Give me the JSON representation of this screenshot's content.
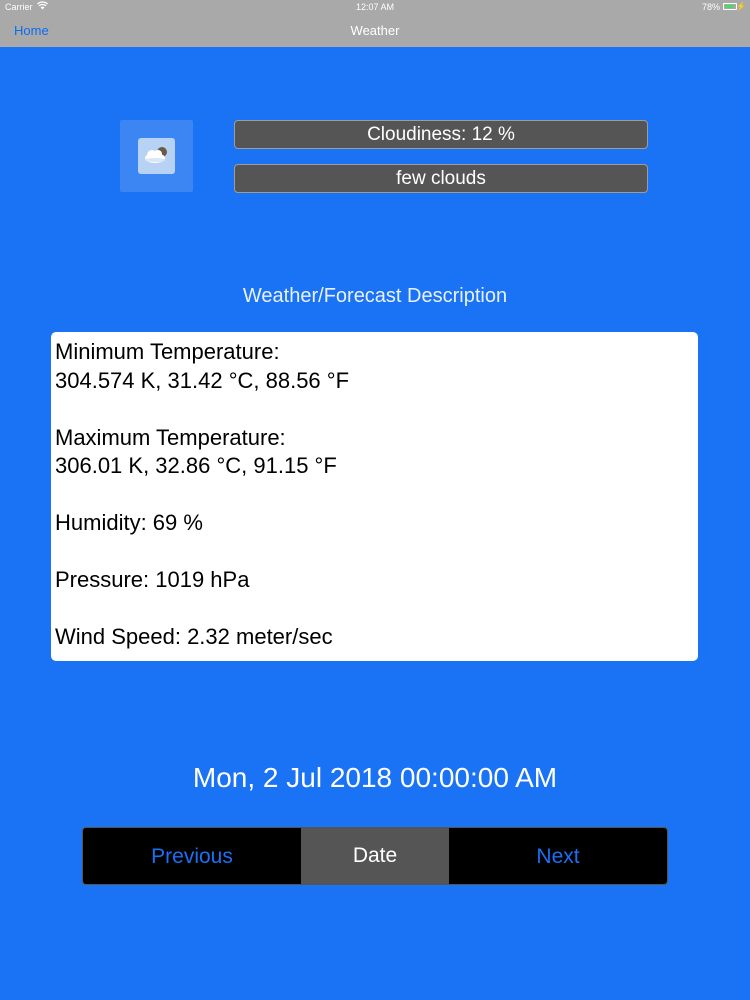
{
  "status_bar": {
    "carrier": "Carrier",
    "time": "12:07 AM",
    "battery": "78%",
    "battery_level": 0.78
  },
  "nav": {
    "back_label": "Home",
    "title": "Weather"
  },
  "weather": {
    "icon": "cloud-sun-icon",
    "cloudiness": "Cloudiness: 12 %",
    "description": "few clouds"
  },
  "section_title": "Weather/Forecast Description",
  "details": {
    "min_temp_label": "Minimum Temperature:",
    "min_temp_value": "304.574 K, 31.42 °C, 88.56 °F",
    "max_temp_label": "Maximum Temperature:",
    "max_temp_value": "306.01 K, 32.86 °C, 91.15 °F",
    "humidity": "Humidity: 69 %",
    "pressure": "Pressure: 1019 hPa",
    "wind": "Wind Speed: 2.32 meter/sec"
  },
  "date": "Mon, 2 Jul 2018 00:00:00 AM",
  "controls": {
    "previous": "Previous",
    "date": "Date",
    "next": "Next"
  },
  "colors": {
    "background": "#1a72f5",
    "bar": "#a9a9a9",
    "accent": "#1b6ff5"
  }
}
